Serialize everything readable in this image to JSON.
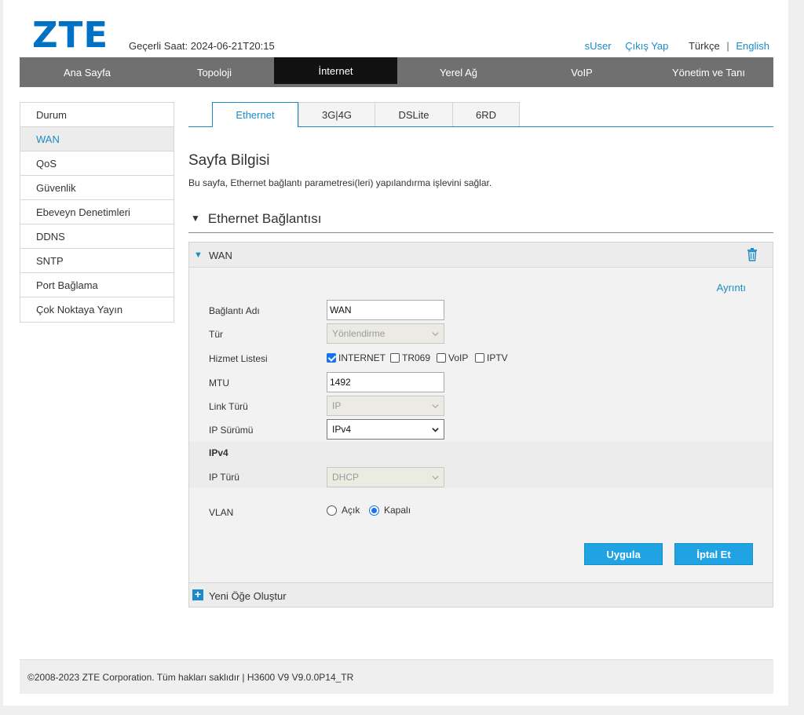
{
  "header": {
    "logo": "ZTE",
    "current_time": "Geçerli Saat: 2024-06-21T20:15",
    "user_link": "sUser",
    "logout_link": "Çıkış Yap",
    "lang_current": "Türkçe",
    "lang_sep": "|",
    "lang_other": "English"
  },
  "nav": {
    "items": [
      {
        "label": "Ana Sayfa"
      },
      {
        "label": "Topoloji"
      },
      {
        "label": "İnternet"
      },
      {
        "label": "Yerel Ağ"
      },
      {
        "label": "VoIP"
      },
      {
        "label": "Yönetim ve Tanı"
      }
    ],
    "active": "İnternet"
  },
  "sidebar": {
    "items": [
      {
        "label": "Durum"
      },
      {
        "label": "WAN"
      },
      {
        "label": "QoS"
      },
      {
        "label": "Güvenlik"
      },
      {
        "label": "Ebeveyn Denetimleri"
      },
      {
        "label": "DDNS"
      },
      {
        "label": "SNTP"
      },
      {
        "label": "Port Bağlama"
      },
      {
        "label": "Çok Noktaya Yayın"
      }
    ],
    "active": "WAN"
  },
  "tabs": {
    "items": [
      {
        "label": "Ethernet"
      },
      {
        "label": "3G|4G"
      },
      {
        "label": "DSLite"
      },
      {
        "label": "6RD"
      }
    ],
    "active": "Ethernet"
  },
  "page": {
    "title": "Sayfa Bilgisi",
    "description": "Bu sayfa, Ethernet bağlantı parametresi(leri) yapılandırma işlevini sağlar.",
    "section_title": "Ethernet Bağlantısı"
  },
  "panel": {
    "title": "WAN",
    "detail_link": "Ayrıntı",
    "labels": {
      "conn_name": "Bağlantı Adı",
      "type": "Tür",
      "service_list": "Hizmet Listesi",
      "mtu": "MTU",
      "link_type": "Link Türü",
      "ip_version": "IP Sürümü",
      "ipv4_title": "IPv4",
      "ip_type": "IP Türü",
      "vlan": "VLAN"
    },
    "values": {
      "conn_name": "WAN",
      "type": "Yönlendirme",
      "mtu": "1492",
      "link_type": "IP",
      "ip_version": "IPv4",
      "ip_type": "DHCP"
    },
    "services": [
      {
        "label": "INTERNET",
        "checked": true
      },
      {
        "label": "TR069",
        "checked": false
      },
      {
        "label": "VoIP",
        "checked": false
      },
      {
        "label": "IPTV",
        "checked": false
      }
    ],
    "vlan_options": [
      {
        "label": "Açık",
        "selected": false
      },
      {
        "label": "Kapalı",
        "selected": true
      }
    ],
    "apply_button": "Uygula",
    "cancel_button": "İptal Et",
    "new_item": "Yeni Öğe Oluştur"
  },
  "footer": {
    "text": "©2008-2023 ZTE Corporation. Tüm hakları saklıdır  |   H3600 V9 V9.0.0P14_TR"
  },
  "colors": {
    "accent": "#1a8bc9",
    "nav_bg": "#707070",
    "nav_active": "#111111",
    "button": "#1fa3e2"
  }
}
